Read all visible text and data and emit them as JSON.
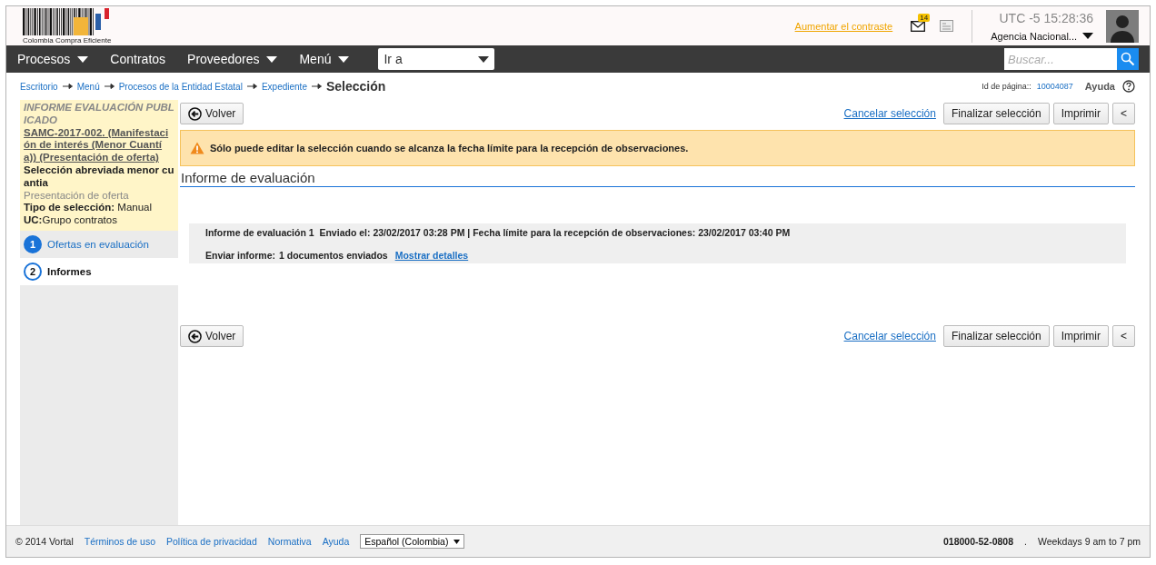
{
  "header": {
    "logo_text": "Colombia Compra Eficiente",
    "contrast_link": "Aumentar el contraste",
    "mail_count": "14",
    "timezone": "UTC -5",
    "time": "15:28:36",
    "agency": "Agencia Nacional..."
  },
  "nav": {
    "items": [
      {
        "label": "Procesos",
        "has_menu": true
      },
      {
        "label": "Contratos",
        "has_menu": false
      },
      {
        "label": "Proveedores",
        "has_menu": true
      },
      {
        "label": "Menú",
        "has_menu": true
      }
    ],
    "goto_select": "Ir a",
    "search": {
      "placeholder": "Buscar..."
    }
  },
  "breadcrumb": {
    "links": [
      "Escritorio",
      "Menú",
      "Procesos de la Entidad Estatal",
      "Expediente"
    ],
    "current": "Selección"
  },
  "page_id": {
    "label": "Id de página::",
    "value": "10004087"
  },
  "help": "Ayuda",
  "sidebar": {
    "status": "INFORME EVALUACIÓN PUBLICADO",
    "process_link": "SAMC-2017-002. (Manifestación de interés (Menor Cuantía)) (Presentación de oferta)",
    "type": "Selección abreviada menor cuantia",
    "phase": "Presentación de oferta",
    "selection_label": "Tipo de selección:",
    "selection_value": "Manual",
    "uc_label": "UC:",
    "uc_value": "Grupo contratos",
    "steps": [
      {
        "number": "1",
        "label": "Ofertas en evaluación",
        "selected": false
      },
      {
        "number": "2",
        "label": "Informes",
        "selected": true
      }
    ]
  },
  "toolbar": {
    "back": "Volver",
    "cancel": "Cancelar selección",
    "finish": "Finalizar selección",
    "print": "Imprimir",
    "collapse": "<"
  },
  "alert": "Sólo puede editar la selección cuando se alcanza la fecha límite para la recepción de observaciones.",
  "section_title": "Informe de evaluación",
  "report": {
    "line": "Informe de evaluación 1  Enviado el: 23/02/2017 03:28 PM | Fecha límite para la recepción de observaciones: 23/02/2017 03:40 PM",
    "send_label": "Enviar informe:",
    "send_value": "1 documentos enviados",
    "details_link": "Mostrar detalles"
  },
  "toolbar_bottom": {
    "back": "Volver",
    "cancel": "Cancelar selección",
    "finish": "Finalizar selección",
    "print": "Imprimir",
    "collapse": "<"
  },
  "footer": {
    "copyright": "© 2014 Vortal",
    "links": [
      "Términos de uso",
      "Política de privacidad",
      "Normativa",
      "Ayuda"
    ],
    "language": "Español (Colombia)",
    "phone": "018000-52-0808",
    "separator": ".",
    "hours": "Weekdays 9 am to 7 pm"
  }
}
